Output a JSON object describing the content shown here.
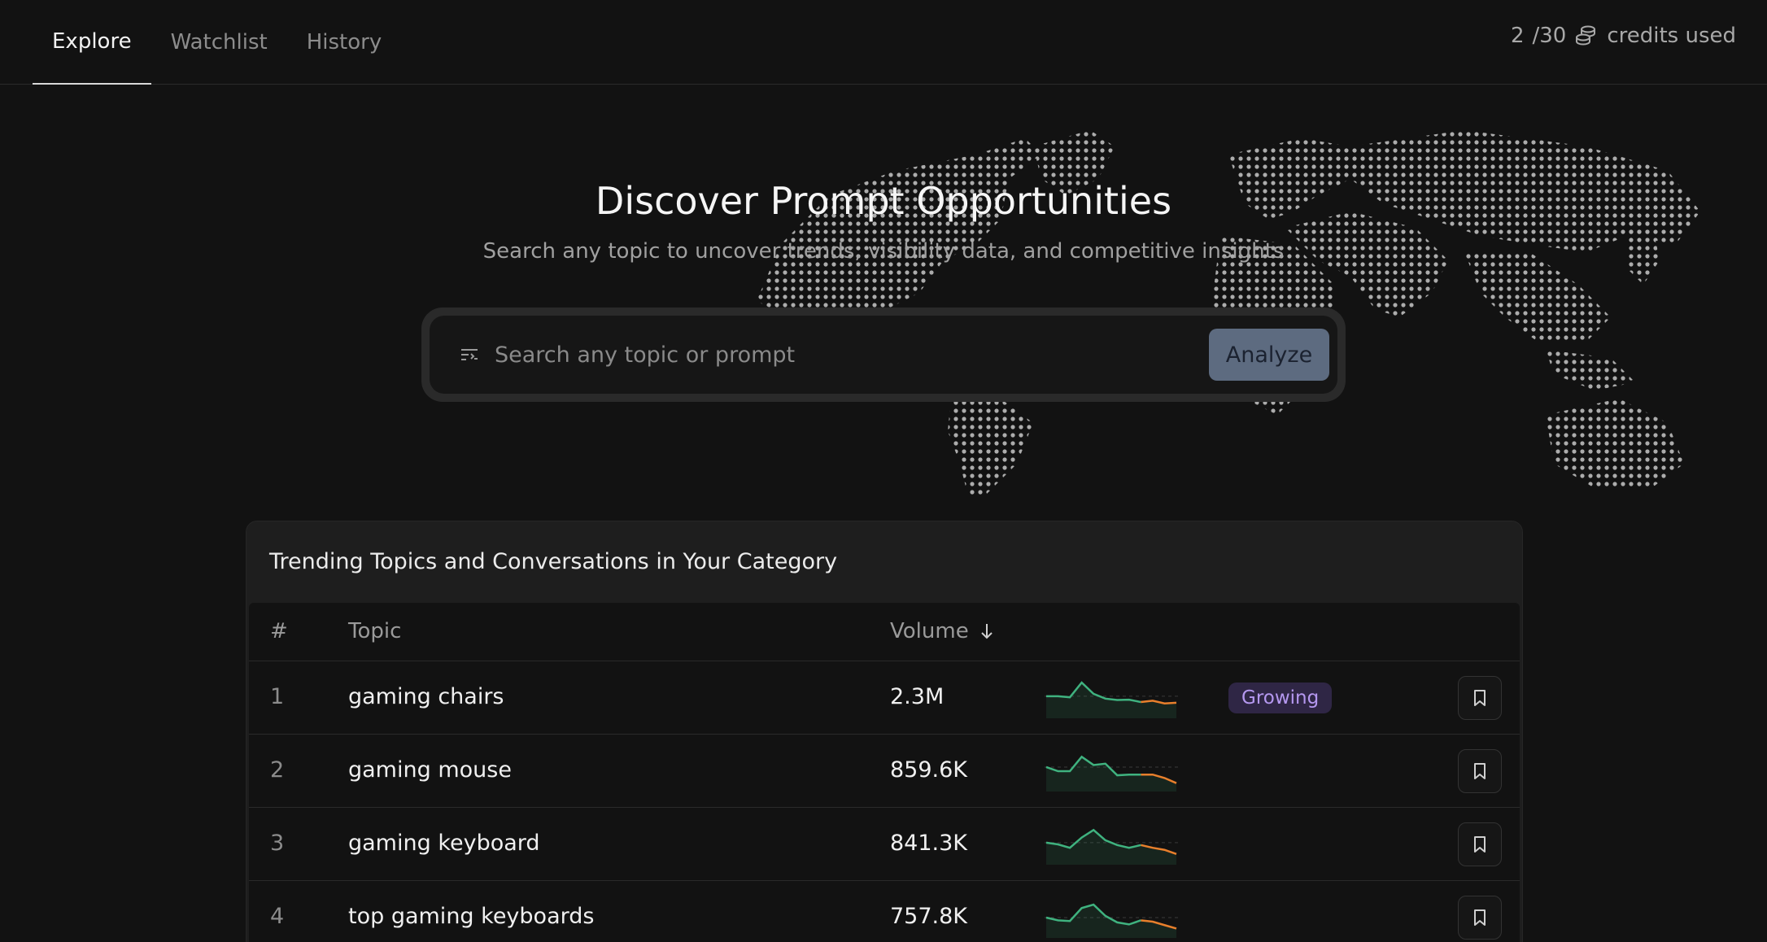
{
  "nav": {
    "tabs": [
      {
        "label": "Explore",
        "active": true
      },
      {
        "label": "Watchlist",
        "active": false
      },
      {
        "label": "History",
        "active": false
      }
    ]
  },
  "credits": {
    "used": "2",
    "total": "/30",
    "label": "credits used",
    "icon": "coins-icon"
  },
  "hero": {
    "title": "Discover Prompt Opportunities",
    "subtitle": "Search any topic to uncover trends, visibility data, and competitive insights"
  },
  "search": {
    "placeholder": "Search any topic or prompt",
    "value": "",
    "button_label": "Analyze",
    "icon": "filter-icon"
  },
  "trending": {
    "title": "Trending Topics and Conversations in Your Category",
    "columns": {
      "rank": "#",
      "topic": "Topic",
      "volume": "Volume",
      "sort": "descending"
    },
    "rows": [
      {
        "rank": "1",
        "topic": "gaming chairs",
        "volume": "2.3M",
        "badge": "Growing",
        "trend": [
          0.55,
          0.55,
          0.52,
          0.95,
          0.62,
          0.48,
          0.44,
          0.45,
          0.38,
          0.42,
          0.34,
          0.36
        ]
      },
      {
        "rank": "2",
        "topic": "gaming mouse",
        "volume": "859.6K",
        "badge": "",
        "trend": [
          0.62,
          0.5,
          0.5,
          0.92,
          0.68,
          0.72,
          0.38,
          0.4,
          0.4,
          0.4,
          0.3,
          0.15
        ]
      },
      {
        "rank": "3",
        "topic": "gaming keyboard",
        "volume": "841.3K",
        "badge": "",
        "trend": [
          0.55,
          0.5,
          0.4,
          0.7,
          0.92,
          0.62,
          0.48,
          0.4,
          0.48,
          0.4,
          0.34,
          0.22
        ]
      },
      {
        "rank": "4",
        "topic": "top gaming keyboards",
        "volume": "757.8K",
        "badge": "",
        "trend": [
          0.5,
          0.42,
          0.4,
          0.78,
          0.88,
          0.55,
          0.36,
          0.3,
          0.42,
          0.38,
          0.28,
          0.18
        ]
      }
    ],
    "colors": {
      "trend_up": "#3fb27f",
      "trend_down": "#e87f2c",
      "badge_bg": "#2f2645",
      "badge_text": "#b598f0"
    }
  }
}
